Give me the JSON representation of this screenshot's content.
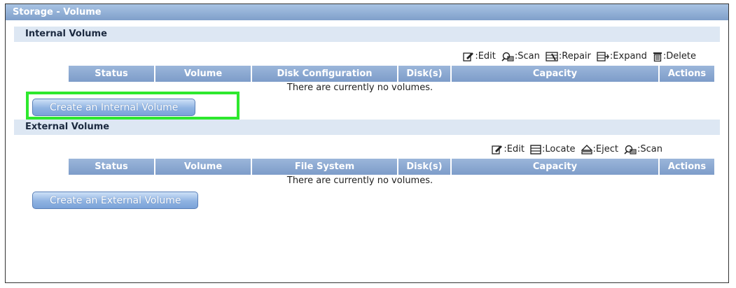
{
  "window": {
    "title": "Storage - Volume"
  },
  "internal": {
    "header": "Internal Volume",
    "legend": [
      {
        "icon": "edit-icon",
        "label": ":Edit"
      },
      {
        "icon": "scan-icon",
        "label": ":Scan"
      },
      {
        "icon": "repair-icon",
        "label": ":Repair"
      },
      {
        "icon": "expand-icon",
        "label": ":Expand"
      },
      {
        "icon": "delete-icon",
        "label": ":Delete"
      }
    ],
    "columns": [
      "Status",
      "Volume",
      "Disk Configuration",
      "Disk(s)",
      "Capacity",
      "Actions"
    ],
    "empty_message": "There are currently no volumes.",
    "button_label": "Create an Internal Volume"
  },
  "external": {
    "header": "External Volume",
    "legend": [
      {
        "icon": "edit-icon",
        "label": ":Edit"
      },
      {
        "icon": "locate-icon",
        "label": ":Locate"
      },
      {
        "icon": "eject-icon",
        "label": ":Eject"
      },
      {
        "icon": "scan-icon",
        "label": ":Scan"
      }
    ],
    "columns": [
      "Status",
      "Volume",
      "File System",
      "Disk(s)",
      "Capacity",
      "Actions"
    ],
    "empty_message": "There are currently no volumes.",
    "button_label": "Create an External Volume"
  },
  "colors": {
    "header_bar": "#7f9fca",
    "section_header": "#dde7f3",
    "highlight": "#2ee82e"
  }
}
